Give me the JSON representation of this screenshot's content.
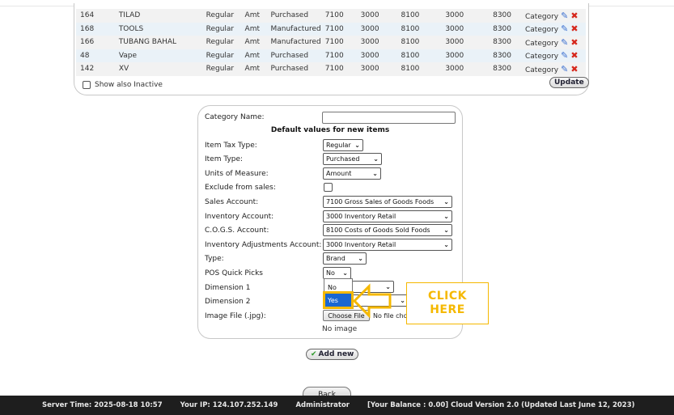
{
  "categories_table": {
    "rows": [
      {
        "id": "164",
        "name": "TILAD",
        "tax": "Regular",
        "units": "Amt",
        "type": "Purchased",
        "sales": "7100",
        "inv": "3000",
        "cogs": "8100",
        "adj": "3000",
        "other": "8300",
        "dim": "Category"
      },
      {
        "id": "168",
        "name": "TOOLS",
        "tax": "Regular",
        "units": "Amt",
        "type": "Manufactured",
        "sales": "7100",
        "inv": "3000",
        "cogs": "8100",
        "adj": "3000",
        "other": "8300",
        "dim": "Category"
      },
      {
        "id": "166",
        "name": "TUBANG BAHAL",
        "tax": "Regular",
        "units": "Amt",
        "type": "Manufactured",
        "sales": "7100",
        "inv": "3000",
        "cogs": "8100",
        "adj": "3000",
        "other": "8300",
        "dim": "Category"
      },
      {
        "id": "48",
        "name": "Vape",
        "tax": "Regular",
        "units": "Amt",
        "type": "Purchased",
        "sales": "7100",
        "inv": "3000",
        "cogs": "8100",
        "adj": "3000",
        "other": "8300",
        "dim": "Category"
      },
      {
        "id": "142",
        "name": "XV",
        "tax": "Regular",
        "units": "Amt",
        "type": "Purchased",
        "sales": "7100",
        "inv": "3000",
        "cogs": "8100",
        "adj": "3000",
        "other": "8300",
        "dim": "Category"
      }
    ],
    "show_inactive_label": "Show also Inactive",
    "update_label": "Update"
  },
  "form": {
    "category_name_label": "Category Name:",
    "category_name_value": "",
    "section_heading": "Default values for new items",
    "item_tax_type_label": "Item Tax Type:",
    "item_tax_type_value": "Regular",
    "item_type_label": "Item Type:",
    "item_type_value": "Purchased",
    "units_label": "Units of Measure:",
    "units_value": "Amount",
    "exclude_label": "Exclude from sales:",
    "sales_account_label": "Sales Account:",
    "sales_account_value": "7100   Gross Sales of Goods Foods",
    "inventory_account_label": "Inventory Account:",
    "inventory_account_value": "3000   Inventory Retail",
    "cogs_account_label": "C.O.G.S. Account:",
    "cogs_account_value": "8100   Costs of Goods Sold Foods",
    "adjustments_account_label": "Inventory Adjustments Account:",
    "adjustments_account_value": "3000   Inventory Retail",
    "type_label": "Type:",
    "type_value": "Brand",
    "pos_quick_picks_label": "POS Quick Picks",
    "pos_quick_picks_value": "No",
    "pos_quick_picks_options": [
      "No",
      "Yes"
    ],
    "dimension1_label": "Dimension 1",
    "dimension2_label": "Dimension 2",
    "image_file_label": "Image File (.jpg):",
    "choose_file_label": "Choose File",
    "no_file_text": "No file chosen",
    "no_image_text": "No image"
  },
  "callout": {
    "line1": "CLICK",
    "line2": "HERE",
    "color": "#f5b800"
  },
  "add_new_label": "Add new",
  "back_label": "Back",
  "footer": {
    "server_time": "Server Time: 2025-08-18 10:57",
    "ip": "Your IP: 124.107.252.149",
    "user": "Administrator",
    "balance_version": "[Your Balance : 0.00] Cloud Version 2.0 (Updated Last June 12, 2023)"
  },
  "colors": {
    "highlight": "#f5b800",
    "selected_option": "#1a67d2",
    "footer_bg": "#1e1e1e"
  }
}
